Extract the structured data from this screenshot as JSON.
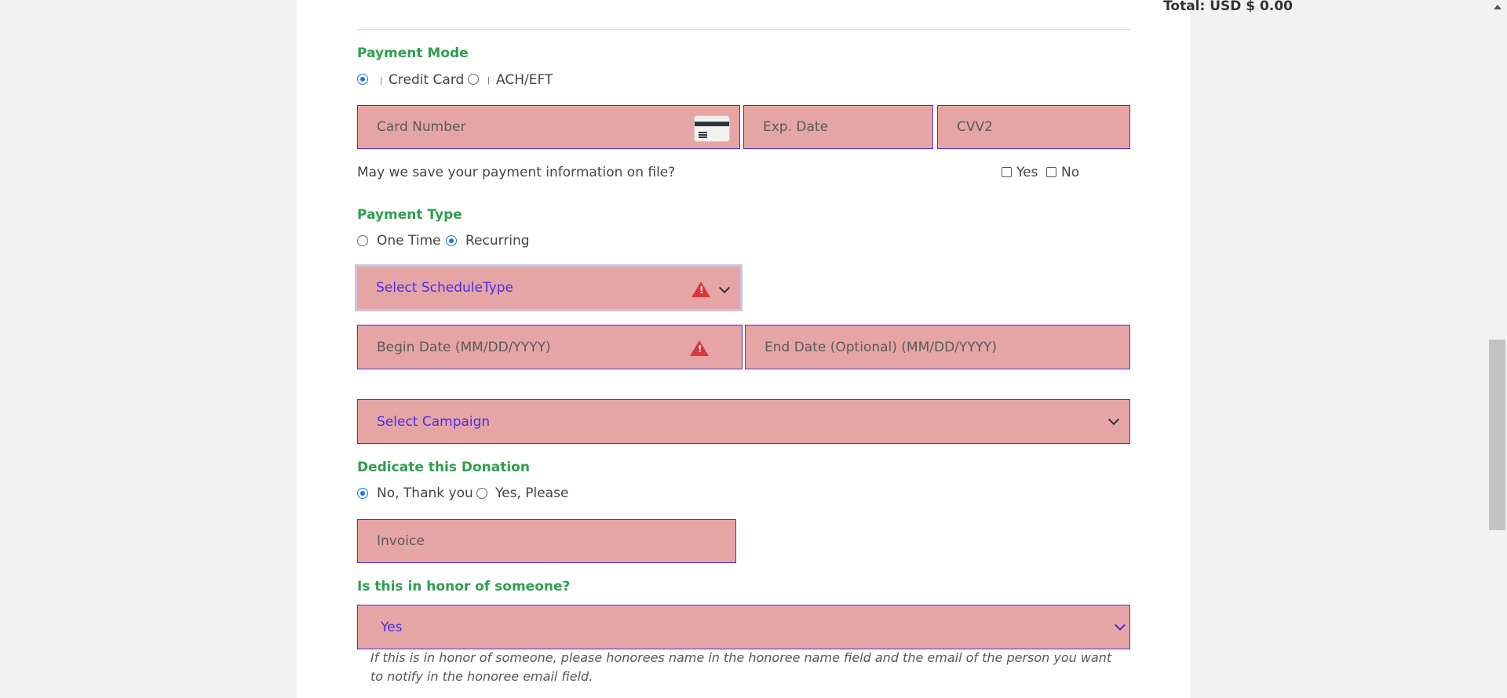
{
  "summary": {
    "total_label": "Total: USD $ 0.00"
  },
  "payment_mode": {
    "title": "Payment Mode",
    "options": [
      {
        "label": "Credit Card",
        "selected": true
      },
      {
        "label": "ACH/EFT",
        "selected": false
      }
    ],
    "card_number_placeholder": "Card Number",
    "card_icon": "credit-card-icon",
    "exp_date_placeholder": "Exp. Date",
    "cvv_placeholder": "CVV2"
  },
  "save_info": {
    "question": "May we save your payment information on file?",
    "yes_label": "Yes",
    "no_label": "No"
  },
  "payment_type": {
    "title": "Payment Type",
    "options": [
      {
        "label": "One Time",
        "selected": false
      },
      {
        "label": "Recurring",
        "selected": true
      }
    ],
    "schedule_select": "Select ScheduleType",
    "begin_date_placeholder": "Begin Date (MM/DD/YYYY)",
    "end_date_placeholder": "End Date (Optional) (MM/DD/YYYY)"
  },
  "campaign": {
    "select": "Select Campaign"
  },
  "dedicate": {
    "title": "Dedicate this Donation",
    "options": [
      {
        "label": "No, Thank you",
        "selected": true
      },
      {
        "label": "Yes, Please",
        "selected": false
      }
    ],
    "invoice_placeholder": "Invoice"
  },
  "honor": {
    "title": "Is this in honor of someone?",
    "selected": "Yes",
    "note": "If this is in honor of someone, please honorees name in the honoree name field and the email of the person you want to notify in the honoree email field."
  },
  "colors": {
    "section_title": "#2e9e4f",
    "field_background": "#e6a5a5",
    "field_border": "#4a2fd6",
    "warning": "#d9363e",
    "radio_selected": "#1a73e8"
  }
}
